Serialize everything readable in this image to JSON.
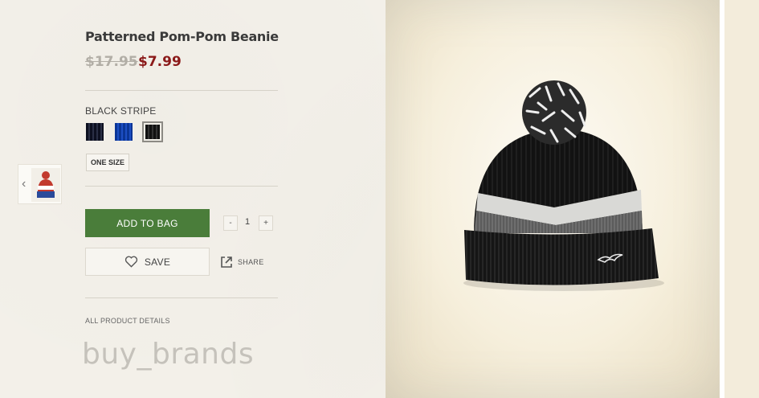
{
  "product": {
    "title": "Patterned Pom-Pom Beanie",
    "price_original": "$17.95",
    "price_sale": "$7.99",
    "color_label": "BLACK STRIPE",
    "swatches": [
      {
        "name": "navy stripe",
        "color": "#1a1e2e"
      },
      {
        "name": "blue",
        "color": "#0f3fa8"
      },
      {
        "name": "black stripe",
        "color": "#1c1c1c",
        "selected": true
      }
    ],
    "size": "ONE SIZE"
  },
  "actions": {
    "add_to_bag": "ADD TO BAG",
    "qty_minus": "-",
    "quantity": "1",
    "qty_plus": "+",
    "save": "SAVE",
    "share": "SHARE"
  },
  "details_link": "ALL PRODUCT DETAILS",
  "watermark": "buy_brands",
  "colors": {
    "accent_green": "#4a7d3a",
    "sale_red": "#8b1a1a",
    "background": "#f4f1ea"
  },
  "icons": {
    "prev": "chevron-left-icon",
    "save": "heart-icon",
    "share": "external-link-icon"
  }
}
